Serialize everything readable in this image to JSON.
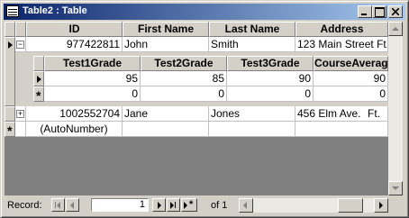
{
  "window": {
    "title": "Table2 : Table"
  },
  "columns": [
    "ID",
    "First Name",
    "Last Name",
    "Address"
  ],
  "records": [
    {
      "id": "977422811",
      "first": "John",
      "last": "Smith",
      "address": "123 Main Street",
      "extra": "Ft."
    },
    {
      "id": "1002552704",
      "first": "Jane",
      "last": "Jones",
      "address": "456 Elm Ave.",
      "extra": "Ft."
    }
  ],
  "new_record": {
    "id": "(AutoNumber)"
  },
  "subdatasheet": {
    "columns": [
      "Test1Grade",
      "Test2Grade",
      "Test3Grade",
      "CourseAverage"
    ],
    "rows": [
      [
        "95",
        "85",
        "90",
        "90"
      ],
      [
        "0",
        "0",
        "0",
        "0"
      ]
    ]
  },
  "navigation": {
    "label": "Record:",
    "current": "1",
    "of_label": "of",
    "total": "1"
  },
  "icons": {
    "expand": "plus-icon",
    "collapse": "minus-icon",
    "current_record": "record-pointer-icon",
    "new_record": "asterisk-icon"
  }
}
